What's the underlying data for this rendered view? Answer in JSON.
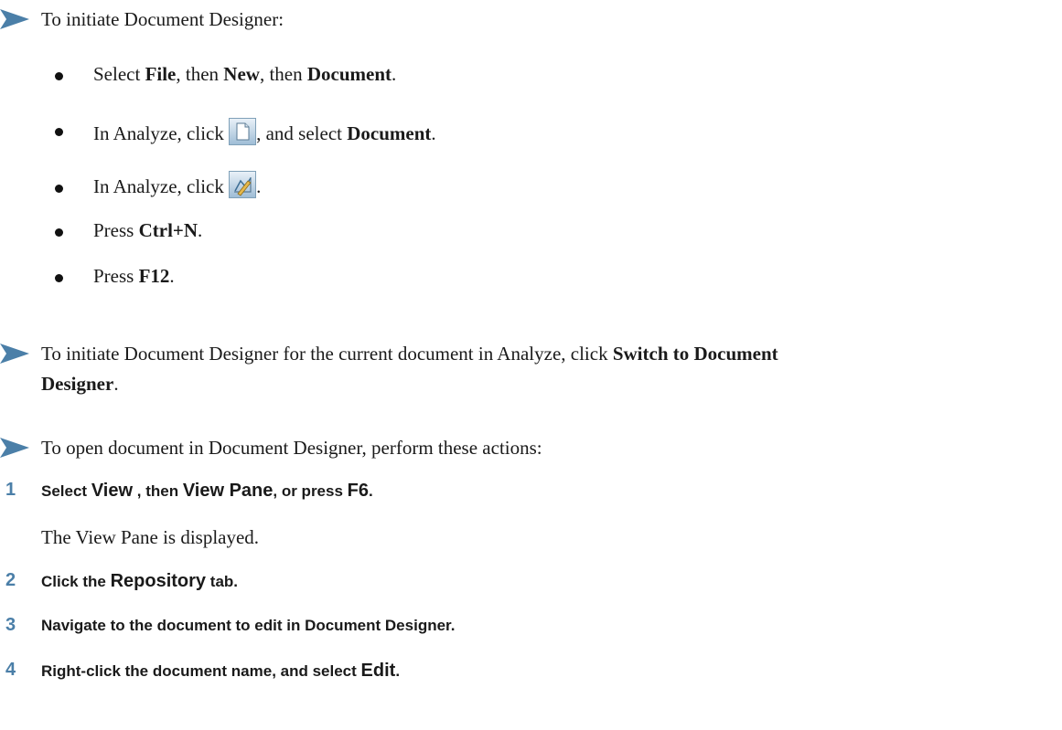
{
  "section1": {
    "intro": "To initiate Document Designer:",
    "bullets": {
      "b1": {
        "t1": "Select ",
        "b_file": "File",
        "t2": ", then ",
        "b_new": "New",
        "t3": ", then ",
        "b_document": "Document",
        "t4": "."
      },
      "b2": {
        "t1": "In Analyze, click ",
        "t2": ", and select ",
        "b_document": "Document",
        "t3": "."
      },
      "b3": {
        "t1": "In Analyze, click ",
        "t2": "."
      },
      "b4": {
        "t1": "Press ",
        "b_key": "Ctrl+N",
        "t2": "."
      },
      "b5": {
        "t1": "Press ",
        "b_key": "F12",
        "t2": "."
      }
    },
    "icons": {
      "new_document": "new-document-icon",
      "document_designer": "document-designer-icon"
    }
  },
  "section2": {
    "t1": "To initiate Document Designer for the current document in Analyze, click ",
    "b1": "Switch to Document",
    "b2": "Designer",
    "t2": "."
  },
  "section3": {
    "intro": "To open document in Document Designer, perform these actions:",
    "steps": {
      "s1": {
        "num": "1",
        "t1": "Select ",
        "b_view": "View",
        "t2": " , then ",
        "b_pane": "View Pane",
        "t3": ", or press ",
        "b_key": "F6",
        "t4": "."
      },
      "s1_note": "The View Pane is displayed.",
      "s2": {
        "num": "2",
        "t1": "Click the ",
        "b_repo": "Repository",
        "t2": " tab."
      },
      "s3": {
        "num": "3",
        "t1": "Navigate to the document to edit in Document Designer."
      },
      "s4": {
        "num": "4",
        "t1": "Right-click the document name, and select ",
        "b_edit": "Edit",
        "t2": "."
      }
    }
  },
  "colors": {
    "arrow": "#4b7fa8",
    "step_number": "#4b7fa8"
  }
}
